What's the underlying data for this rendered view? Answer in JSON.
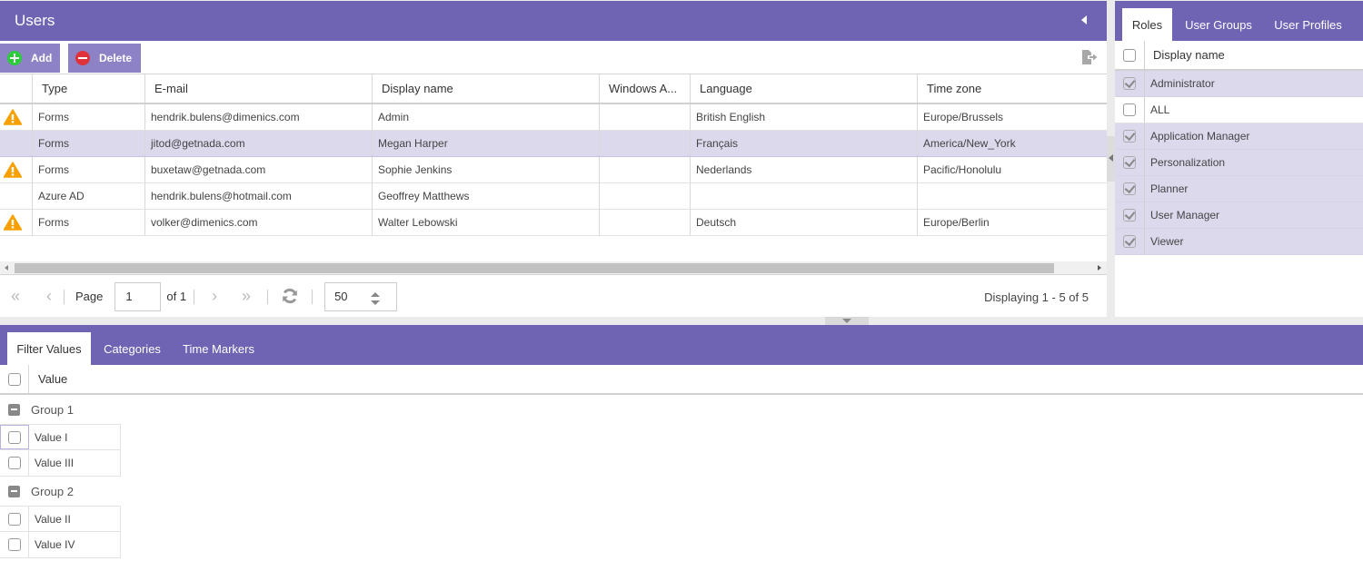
{
  "users": {
    "title": "Users",
    "toolbar": {
      "add_label": "Add",
      "delete_label": "Delete"
    },
    "columns": [
      "",
      "Type",
      "E-mail",
      "Display name",
      "Windows A...",
      "Language",
      "Time zone"
    ],
    "rows": [
      {
        "warning": true,
        "type": "Forms",
        "email": "hendrik.bulens@dimenics.com",
        "display_name": "Admin",
        "windows_account": "",
        "language": "British English",
        "time_zone": "Europe/Brussels"
      },
      {
        "warning": false,
        "type": "Forms",
        "email": "jitod@getnada.com",
        "display_name": "Megan Harper",
        "windows_account": "",
        "language": "Français",
        "time_zone": "America/New_York"
      },
      {
        "warning": true,
        "type": "Forms",
        "email": "buxetaw@getnada.com",
        "display_name": "Sophie Jenkins",
        "windows_account": "",
        "language": "Nederlands",
        "time_zone": "Pacific/Honolulu"
      },
      {
        "warning": false,
        "type": "Azure AD",
        "email": "hendrik.bulens@hotmail.com",
        "display_name": "Geoffrey Matthews",
        "windows_account": "",
        "language": "",
        "time_zone": ""
      },
      {
        "warning": true,
        "type": "Forms",
        "email": "volker@dimenics.com",
        "display_name": "Walter Lebowski",
        "windows_account": "",
        "language": "Deutsch",
        "time_zone": "Europe/Berlin"
      }
    ],
    "selected_row": 1,
    "pager": {
      "page_label": "Page",
      "page_value": "1",
      "of_label": "of 1",
      "page_size": "50",
      "displaying": "Displaying 1 - 5 of 5"
    }
  },
  "roles_panel": {
    "tabs": [
      "Roles",
      "User Groups",
      "User Profiles"
    ],
    "active_tab": 0,
    "header": "Display name",
    "rows": [
      {
        "name": "Administrator",
        "checked": true
      },
      {
        "name": "ALL",
        "checked": false
      },
      {
        "name": "Application Manager",
        "checked": true
      },
      {
        "name": "Personalization",
        "checked": true
      },
      {
        "name": "Planner",
        "checked": true
      },
      {
        "name": "User Manager",
        "checked": true
      },
      {
        "name": "Viewer",
        "checked": true
      }
    ]
  },
  "filter_panel": {
    "tabs": [
      "Filter Values",
      "Categories",
      "Time Markers"
    ],
    "active_tab": 0,
    "header": "Value",
    "groups": [
      {
        "name": "Group 1",
        "values": [
          "Value I",
          "Value III"
        ]
      },
      {
        "name": "Group 2",
        "values": [
          "Value II",
          "Value IV"
        ]
      }
    ]
  },
  "colors": {
    "header_purple": "#6f63b3",
    "button_purple": "#8c82c5",
    "selected_row": "#dcd9ed",
    "warning_orange": "#f7a000",
    "add_green": "#2bcc3c",
    "delete_red": "#e0323a"
  }
}
